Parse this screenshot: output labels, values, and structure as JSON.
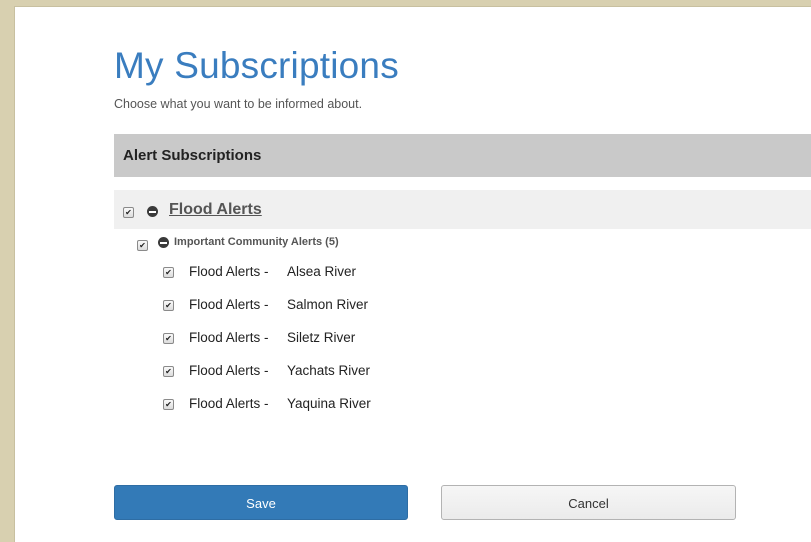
{
  "page": {
    "title": "My Subscriptions",
    "subtitle": "Choose what you want to be informed about."
  },
  "section": {
    "header": "Alert Subscriptions"
  },
  "group": {
    "label": "Flood Alerts",
    "checked": true,
    "subgroup": {
      "label": "Important Community Alerts (5)",
      "checked": true,
      "items": [
        {
          "kind": "Flood Alerts -",
          "river": "Alsea River",
          "checked": true
        },
        {
          "kind": "Flood Alerts -",
          "river": "Salmon River",
          "checked": true
        },
        {
          "kind": "Flood Alerts -",
          "river": "Siletz River",
          "checked": true
        },
        {
          "kind": "Flood Alerts -",
          "river": "Yachats River",
          "checked": true
        },
        {
          "kind": "Flood Alerts -",
          "river": "Yaquina River",
          "checked": true
        }
      ]
    }
  },
  "buttons": {
    "save": "Save",
    "cancel": "Cancel"
  },
  "colors": {
    "accent": "#3a7dbf",
    "save_bg": "#337ab7",
    "page_bg": "#d8d0b0"
  }
}
